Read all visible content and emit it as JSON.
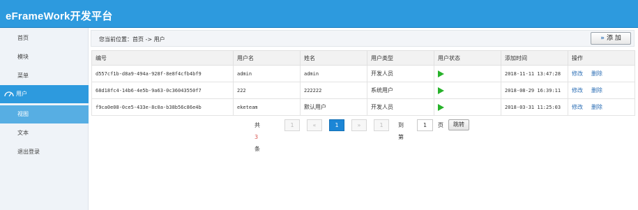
{
  "app": {
    "title": "eFrameWork开发平台"
  },
  "sidebar": {
    "items": [
      {
        "label": "首页"
      },
      {
        "label": "模块"
      },
      {
        "label": "菜单"
      },
      {
        "label": "用户"
      },
      {
        "label": "视图"
      },
      {
        "label": "文本"
      },
      {
        "label": "退出登录"
      }
    ]
  },
  "breadcrumb": {
    "text": "您当前位置：首页 -> 用户"
  },
  "toolbar": {
    "add_icon": "»",
    "add_label": "添 加"
  },
  "table": {
    "headers": [
      "编号",
      "用户名",
      "姓名",
      "用户类型",
      "用户状态",
      "添加时间",
      "操作"
    ],
    "rows": [
      {
        "id": "d557cf1b-d8a9-494a-928f-8e8f4cfb4bf9",
        "username": "admin",
        "name": "admin",
        "type": "开发人员",
        "status_icon": "play-icon",
        "time": "2018-11-11 13:47:28",
        "edit": "修改",
        "delete": "删除"
      },
      {
        "id": "68d18fc4-14b6-4e5b-9a63-0c36043550f7",
        "username": "222",
        "name": "222222",
        "type": "系统用户",
        "status_icon": "play-icon",
        "time": "2018-08-29 16:39:11",
        "edit": "修改",
        "delete": "删除"
      },
      {
        "id": "f9ca0e08-0ce5-433e-8c0a-b38b56c86e4b",
        "username": "eketeam",
        "name": "默认用户",
        "type": "开发人员",
        "status_icon": "play-icon",
        "time": "2018-03-31 11:25:03",
        "edit": "修改",
        "delete": "删除"
      }
    ]
  },
  "pager": {
    "total_prefix": "共",
    "total_count": "3",
    "total_suffix": "条",
    "first": "1",
    "prev": "«",
    "current": "1",
    "next": "»",
    "last": "1",
    "goto_label": "到第",
    "goto_value": "1",
    "page_label": "页",
    "jump_label": "跳转"
  },
  "colors": {
    "header": "#2d9ade",
    "active_child": "#57aee3",
    "status_green": "#27b22a",
    "link": "#2d6fb5"
  }
}
